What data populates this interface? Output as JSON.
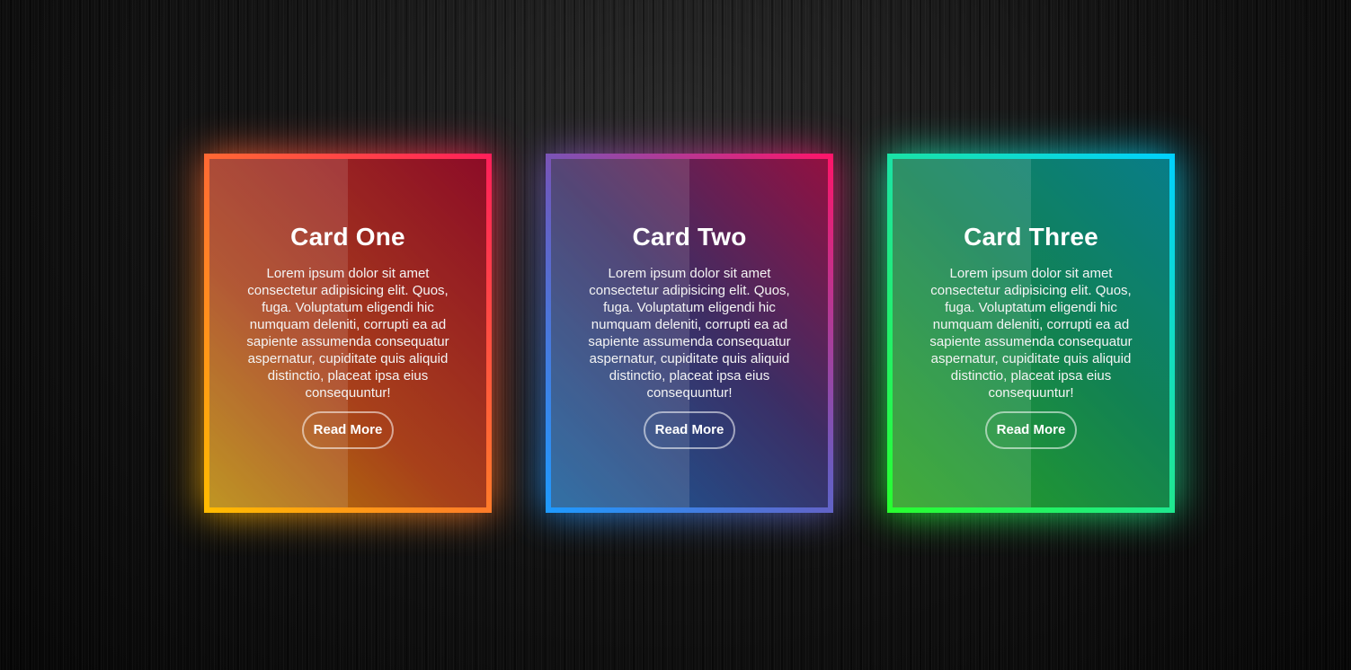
{
  "cards": [
    {
      "title": "Card One",
      "body": "Lorem ipsum dolor sit amet consectetur adipisicing elit. Quos, fuga. Voluptatum eligendi hic numquam deleniti, corrupti ea ad sapiente assumenda consequatur aspernatur, cupiditate quis aliquid distinctio, placeat ipsa eius consequuntur!",
      "button_label": "Read More",
      "gradient_colors": [
        "#ffbc00",
        "#ff7a2a",
        "#ff1e5a"
      ]
    },
    {
      "title": "Card Two",
      "body": "Lorem ipsum dolor sit amet consectetur adipisicing elit. Quos, fuga. Voluptatum eligendi hic numquam deleniti, corrupti ea ad sapiente assumenda consequatur aspernatur, cupiditate quis aliquid distinctio, placeat ipsa eius consequuntur!",
      "button_label": "Read More",
      "gradient_colors": [
        "#1e9bff",
        "#6a5cc0",
        "#ff1468"
      ]
    },
    {
      "title": "Card Three",
      "body": "Lorem ipsum dolor sit amet consectetur adipisicing elit. Quos, fuga. Voluptatum eligendi hic numquam deleniti, corrupti ea ad sapiente assumenda consequatur aspernatur, cupiditate quis aliquid distinctio, placeat ipsa eius consequuntur!",
      "button_label": "Read More",
      "gradient_colors": [
        "#29ff2e",
        "#1ee59a",
        "#00d0ff"
      ]
    }
  ],
  "background_color": "#0b0b0b"
}
